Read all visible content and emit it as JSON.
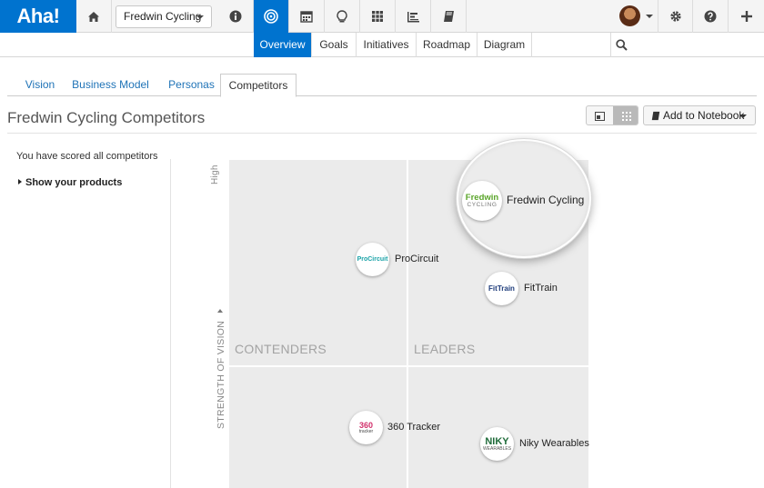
{
  "app": {
    "logo_text": "Aha!"
  },
  "topbar": {
    "workspace_label": "Fredwin Cycling",
    "icons": [
      "home-icon",
      "info-icon",
      "strategy-icon",
      "calendar-icon",
      "lightbulb-icon",
      "grid-icon",
      "roadmap-icon",
      "notebook-icon",
      "settings-icon",
      "help-icon",
      "plus-icon"
    ]
  },
  "subnav": {
    "items": [
      {
        "label": "Overview",
        "active": true
      },
      {
        "label": "Goals"
      },
      {
        "label": "Initiatives"
      },
      {
        "label": "Roadmap"
      },
      {
        "label": "Diagram"
      }
    ]
  },
  "tabs": [
    {
      "label": "Vision"
    },
    {
      "label": "Business Model"
    },
    {
      "label": "Personas"
    },
    {
      "label": "Competitors",
      "active": true
    }
  ],
  "page": {
    "title": "Fredwin Cycling Competitors",
    "add_to_notebook": "Add to Notebook"
  },
  "left_panel": {
    "scored_text": "You have scored all competitors",
    "show_products": "Show your products"
  },
  "chart": {
    "y_axis_label": "STRENGTH OF VISION",
    "y_axis_high": "High",
    "quadrants": {
      "contenders": "CONTENDERS",
      "leaders": "LEADERS"
    },
    "competitors": [
      {
        "name": "Fredwin Cycling",
        "logo_line1": "Fredwin",
        "logo_line2": "CYCLING",
        "highlighted": true
      },
      {
        "name": "ProCircuit",
        "logo_text": "ProCircuit"
      },
      {
        "name": "FitTrain",
        "logo_text": "FitTrain"
      },
      {
        "name": "360 Tracker",
        "logo_text": "360",
        "logo_sub": "tracker"
      },
      {
        "name": "Niky Wearables",
        "logo_text": "NIKY",
        "logo_sub": "WEARABLES"
      }
    ]
  },
  "colors": {
    "brand": "#0073cf",
    "link": "#1f73b7",
    "quadrant": "#ebebeb"
  }
}
